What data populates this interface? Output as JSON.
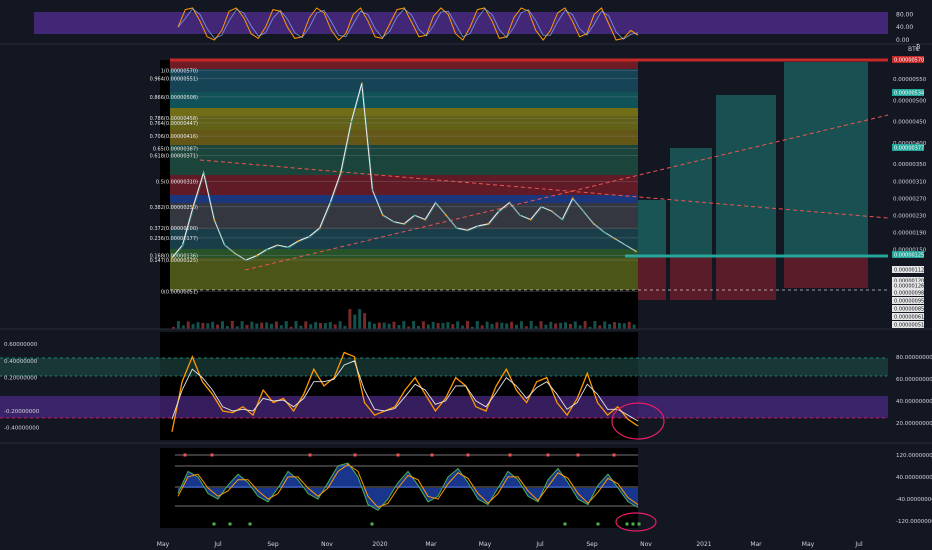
{
  "symbol_suffix": "BTC",
  "currency_badge": "₿",
  "colors": {
    "bg": "#131722",
    "grid": "#2a2e39",
    "purple_band": "#4b2a86",
    "teal": "#1f7f7a",
    "orange": "#ff9800",
    "white": "#e6e6e6",
    "green": "#26a69a",
    "red": "#ef5350",
    "pink": "#e91e63",
    "blue_fill": "#2962ff"
  },
  "time_axis": {
    "labels": [
      "May",
      "Jul",
      "Sep",
      "Nov",
      "2020",
      "Mar",
      "May",
      "Jul",
      "Sep",
      "Nov",
      "2021",
      "Mar",
      "May",
      "Jul"
    ]
  },
  "chart_data": [
    {
      "type": "line",
      "panel": "stochastic_top",
      "yticks": [
        80.0,
        40.0,
        0.0
      ],
      "ylim": [
        0,
        100
      ],
      "series": [
        {
          "values": [
            40,
            95,
            100,
            60,
            10,
            0,
            30,
            90,
            100,
            70,
            20,
            5,
            40,
            95,
            90,
            40,
            5,
            10,
            70,
            100,
            85,
            30,
            0,
            20,
            80,
            100,
            60,
            10,
            5,
            50,
            95,
            100,
            55,
            10,
            15,
            75,
            100,
            80,
            20,
            0,
            40,
            95,
            100,
            60,
            5,
            10,
            70,
            100,
            90,
            30,
            0,
            30,
            85,
            100,
            60,
            10,
            20,
            80,
            100,
            50,
            0,
            5,
            30,
            15
          ]
        }
      ]
    },
    {
      "type": "line",
      "panel": "price",
      "ylabel": "BTC",
      "yticks": [
        5.5e-06,
        5e-06,
        4.5e-06,
        4e-06,
        3.5e-06,
        3.1e-06,
        2.7e-06,
        2.3e-06,
        1.9e-06,
        1.5e-06
      ],
      "ylim": [
        5e-07,
        5.9e-06
      ],
      "fib_levels": [
        {
          "label": "1(0.00000570)",
          "value": 5.7e-06
        },
        {
          "label": "0.964(0.00000551)",
          "value": 5.51e-06
        },
        {
          "label": "0.866(0.00000508)",
          "value": 5.08e-06
        },
        {
          "label": "0.786(0.00000458)",
          "value": 4.58e-06
        },
        {
          "label": "0.764(0.00000447)",
          "value": 4.47e-06
        },
        {
          "label": "0.706(0.00000416)",
          "value": 4.16e-06
        },
        {
          "label": "0.65(0.00000387)",
          "value": 3.87e-06
        },
        {
          "label": "0.618(0.00000371)",
          "value": 3.71e-06
        },
        {
          "label": "0.5(0.00000310)",
          "value": 3.1e-06
        },
        {
          "label": "0.382(0.00000250)",
          "value": 2.5e-06
        },
        {
          "label": "0.372(0.00000200)",
          "value": 2e-06
        },
        {
          "label": "0.236(0.00000177)",
          "value": 1.77e-06
        },
        {
          "label": "0.168(0.00000136)",
          "value": 1.36e-06
        },
        {
          "label": "0.147(0.00000125)",
          "value": 1.25e-06
        },
        {
          "label": "0(0.00000051)",
          "value": 5.1e-07
        }
      ],
      "series": [
        {
          "values": [
            1.3e-06,
            1.6e-06,
            2.5e-06,
            3.3e-06,
            2.2e-06,
            1.6e-06,
            1.4e-06,
            1.25e-06,
            1.35e-06,
            1.5e-06,
            1.6e-06,
            1.55e-06,
            1.7e-06,
            1.8e-06,
            2e-06,
            2.6e-06,
            3.3e-06,
            4.5e-06,
            5.4e-06,
            2.9e-06,
            2.3e-06,
            2.15e-06,
            2.1e-06,
            2.3e-06,
            2.2e-06,
            2.6e-06,
            2.3e-06,
            2e-06,
            1.95e-06,
            2.05e-06,
            2.1e-06,
            2.4e-06,
            2.6e-06,
            2.3e-06,
            2.2e-06,
            2.5e-06,
            2.4e-06,
            2.2e-06,
            2.7e-06,
            2.4e-06,
            2.1e-06,
            1.9e-06,
            1.75e-06,
            1.6e-06,
            1.45e-06
          ]
        }
      ],
      "right_labels": [
        "0.00000570",
        "0.00000534",
        "0.00000377",
        "0.00000125",
        "0.00000112",
        "0.00000120",
        "0.00000126",
        "0.00000098",
        "0.00000095",
        "0.00000085",
        "0.00000061",
        "0.00000051"
      ]
    },
    {
      "type": "line",
      "panel": "oscillator",
      "yticks_left": [
        0.6,
        0.4,
        0.2,
        -0.2,
        -0.4
      ],
      "yticks_right": [
        80.0,
        60.0,
        40.0,
        20.0
      ],
      "ylim": [
        -0.5,
        0.65
      ],
      "series": [
        {
          "values": [
            -0.45,
            0.15,
            0.45,
            0.15,
            0.0,
            -0.2,
            -0.22,
            -0.15,
            -0.25,
            0.05,
            -0.1,
            -0.05,
            -0.2,
            0.0,
            0.3,
            0.1,
            0.2,
            0.5,
            0.45,
            -0.1,
            -0.25,
            -0.2,
            -0.15,
            0.05,
            0.2,
            0.0,
            -0.2,
            -0.05,
            0.2,
            0.1,
            -0.15,
            -0.2,
            0.1,
            0.3,
            0.05,
            -0.1,
            0.15,
            0.2,
            -0.1,
            -0.25,
            -0.05,
            0.25,
            -0.1,
            -0.25,
            -0.15,
            -0.3,
            -0.38
          ]
        },
        {
          "values": [
            -0.3,
            0.05,
            0.3,
            0.2,
            0.05,
            -0.15,
            -0.2,
            -0.18,
            -0.2,
            -0.05,
            -0.08,
            -0.07,
            -0.15,
            -0.05,
            0.15,
            0.15,
            0.18,
            0.35,
            0.4,
            0.05,
            -0.18,
            -0.2,
            -0.17,
            -0.03,
            0.12,
            0.05,
            -0.12,
            -0.08,
            0.1,
            0.1,
            -0.08,
            -0.15,
            0.02,
            0.2,
            0.1,
            -0.05,
            0.08,
            0.15,
            0.0,
            -0.18,
            -0.1,
            0.12,
            0.0,
            -0.18,
            -0.18,
            -0.25,
            -0.32
          ]
        }
      ]
    },
    {
      "type": "area",
      "panel": "wave",
      "yticks": [
        120.0,
        40.0,
        -40.0,
        -120.0
      ],
      "ylim": [
        -130,
        130
      ],
      "series": [
        {
          "values": [
            -20,
            60,
            40,
            -20,
            -40,
            10,
            50,
            20,
            -30,
            -50,
            0,
            60,
            30,
            -20,
            -40,
            20,
            80,
            90,
            40,
            -60,
            -80,
            -40,
            20,
            60,
            10,
            -50,
            -30,
            40,
            70,
            20,
            -40,
            -60,
            0,
            60,
            30,
            -30,
            -50,
            30,
            70,
            20,
            -40,
            -60,
            10,
            50,
            0,
            -50,
            -70
          ]
        },
        {
          "values": [
            -30,
            40,
            50,
            0,
            -30,
            -10,
            30,
            30,
            -10,
            -40,
            -20,
            40,
            40,
            0,
            -30,
            0,
            60,
            85,
            60,
            -30,
            -70,
            -55,
            0,
            45,
            30,
            -30,
            -40,
            15,
            55,
            35,
            -20,
            -55,
            -20,
            40,
            40,
            -10,
            -45,
            5,
            55,
            35,
            -20,
            -55,
            -15,
            35,
            15,
            -35,
            -60
          ]
        }
      ]
    }
  ]
}
